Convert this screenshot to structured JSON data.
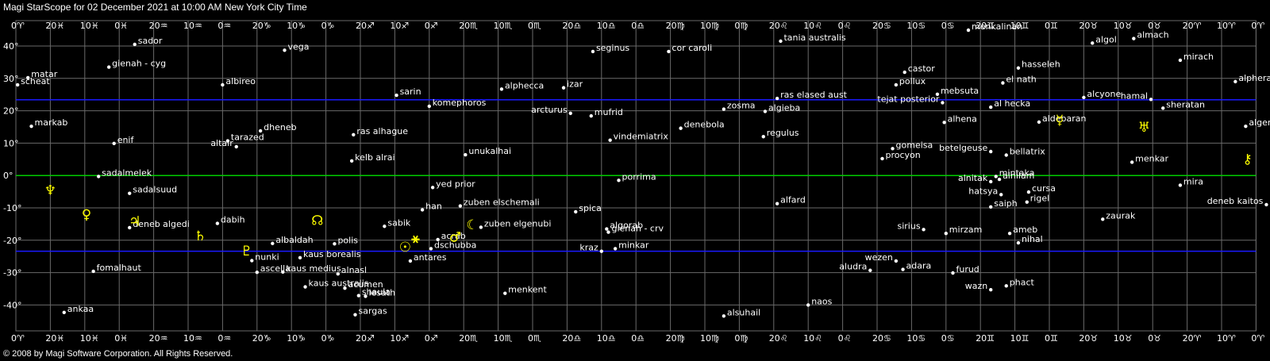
{
  "title": "Magi StarScope for 02 December 2021 at 10:00 AM New York City Time",
  "footer": "© 2008 by Magi Software Corporation. All Rights Reserved.",
  "colors": {
    "background": "#000000",
    "grid": "#6a6a6a",
    "celestial_equator": "#00cc00",
    "ecliptic_bounds": "#1a1aff",
    "star": "#ffffff",
    "planet": "#ffff00"
  },
  "axis": {
    "top_ticks": [
      "0♈",
      "20♓",
      "10♓",
      "0♓",
      "20♒",
      "10♒",
      "0♒",
      "20♑",
      "10♑",
      "0♑",
      "20♐",
      "10♐",
      "0♐",
      "20♏",
      "10♏",
      "0♏",
      "20♎",
      "10♎",
      "0♎",
      "20♍",
      "10♍",
      "0♍",
      "20♌",
      "10♌",
      "0♌",
      "20♋",
      "10♋",
      "0♋",
      "20♊",
      "10♊",
      "0♊",
      "20♉",
      "10♉",
      "0♉",
      "20♈",
      "10♈",
      "0♈"
    ],
    "left_ticks": [
      "40°",
      "30°",
      "20°",
      "10°",
      "0°",
      "-10°",
      "-20°",
      "-30°",
      "-40°"
    ],
    "y_values": [
      40,
      30,
      20,
      10,
      0,
      -10,
      -20,
      -30,
      -40
    ],
    "y_range": [
      -47,
      45
    ],
    "ecliptic_bounds": [
      23.4,
      -23.4
    ]
  },
  "stars": [
    {
      "name": "sador",
      "col": 3.45,
      "dec": 40.5
    },
    {
      "name": "gienah - cyg",
      "col": 2.7,
      "dec": 33.5
    },
    {
      "name": "vega",
      "col": 7.8,
      "dec": 38.7
    },
    {
      "name": "matar",
      "col": 0.35,
      "dec": 30.2
    },
    {
      "name": "scheat",
      "col": 0.05,
      "dec": 28.0
    },
    {
      "name": "albireo",
      "col": 6.0,
      "dec": 28.0
    },
    {
      "name": "markab",
      "col": 0.45,
      "dec": 15.2
    },
    {
      "name": "dheneb",
      "col": 7.1,
      "dec": 13.8
    },
    {
      "name": "enif",
      "col": 2.85,
      "dec": 9.9
    },
    {
      "name": "tarazed",
      "col": 6.15,
      "dec": 10.7
    },
    {
      "name": "altair",
      "col": 6.4,
      "dec": 8.9,
      "label_left": true
    },
    {
      "name": "sadalmelek",
      "col": 2.4,
      "dec": -0.3
    },
    {
      "name": "sadalsuud",
      "col": 3.3,
      "dec": -5.5
    },
    {
      "name": "deneb algedi",
      "col": 3.3,
      "dec": -16.1
    },
    {
      "name": "dabih",
      "col": 5.85,
      "dec": -14.8
    },
    {
      "name": "fomalhaut",
      "col": 2.25,
      "dec": -29.6
    },
    {
      "name": "ankaa",
      "col": 1.4,
      "dec": -42.3
    },
    {
      "name": "sarin",
      "col": 11.05,
      "dec": 24.8
    },
    {
      "name": "komephoros",
      "col": 12.0,
      "dec": 21.4
    },
    {
      "name": "ras alhague",
      "col": 9.8,
      "dec": 12.6
    },
    {
      "name": "kelb alrai",
      "col": 9.75,
      "dec": 4.5
    },
    {
      "name": "yed prior",
      "col": 12.1,
      "dec": -3.7
    },
    {
      "name": "han",
      "col": 11.8,
      "dec": -10.6
    },
    {
      "name": "sabik",
      "col": 10.7,
      "dec": -15.7
    },
    {
      "name": "albaldah",
      "col": 7.45,
      "dec": -21.0
    },
    {
      "name": "polis",
      "col": 9.25,
      "dec": -21.1
    },
    {
      "name": "nunki",
      "col": 6.85,
      "dec": -26.3
    },
    {
      "name": "kaus borealis",
      "col": 8.25,
      "dec": -25.4
    },
    {
      "name": "ascella",
      "col": 7.0,
      "dec": -29.9
    },
    {
      "name": "kaus medius",
      "col": 7.75,
      "dec": -29.8
    },
    {
      "name": "alnasl",
      "col": 9.35,
      "dec": -30.4
    },
    {
      "name": "kaus australis",
      "col": 8.4,
      "dec": -34.4
    },
    {
      "name": "acumen",
      "col": 9.55,
      "dec": -34.8
    },
    {
      "name": "shaula",
      "col": 9.95,
      "dec": -37.1
    },
    {
      "name": "lesath",
      "col": 10.15,
      "dec": -37.3
    },
    {
      "name": "sargas",
      "col": 9.85,
      "dec": -43.0
    },
    {
      "name": "acrab",
      "col": 12.25,
      "dec": -19.8
    },
    {
      "name": "dschubba",
      "col": 12.05,
      "dec": -22.6
    },
    {
      "name": "antares",
      "col": 11.45,
      "dec": -26.4
    },
    {
      "name": "unukalhai",
      "col": 13.05,
      "dec": 6.4
    },
    {
      "name": "zuben elschemali",
      "col": 12.9,
      "dec": -9.4
    },
    {
      "name": "zuben elgenubi",
      "col": 13.5,
      "dec": -16.0
    },
    {
      "name": "menkent",
      "col": 14.2,
      "dec": -36.4
    },
    {
      "name": "alphecca",
      "col": 14.1,
      "dec": 26.7
    },
    {
      "name": "izar",
      "col": 15.9,
      "dec": 27.1
    },
    {
      "name": "arcturus",
      "col": 16.1,
      "dec": 19.2,
      "label_left": true
    },
    {
      "name": "mufrid",
      "col": 16.7,
      "dec": 18.4
    },
    {
      "name": "seginus",
      "col": 16.75,
      "dec": 38.3
    },
    {
      "name": "vindemiatrix",
      "col": 17.25,
      "dec": 10.9
    },
    {
      "name": "spica",
      "col": 16.25,
      "dec": -11.2
    },
    {
      "name": "porrima",
      "col": 17.5,
      "dec": -1.5
    },
    {
      "name": "algorab",
      "col": 17.15,
      "dec": -16.5
    },
    {
      "name": "gienah - crv",
      "col": 17.2,
      "dec": -17.5
    },
    {
      "name": "kraz",
      "col": 17.0,
      "dec": -23.4,
      "label_left": true
    },
    {
      "name": "minkar",
      "col": 17.4,
      "dec": -22.6
    },
    {
      "name": "cor caroli",
      "col": 18.95,
      "dec": 38.3
    },
    {
      "name": "denebola",
      "col": 19.3,
      "dec": 14.6
    },
    {
      "name": "zosma",
      "col": 20.55,
      "dec": 20.5
    },
    {
      "name": "algieba",
      "col": 21.75,
      "dec": 19.8
    },
    {
      "name": "regulus",
      "col": 21.7,
      "dec": 12.0
    },
    {
      "name": "ras elased aust",
      "col": 22.1,
      "dec": 23.8
    },
    {
      "name": "tania australis",
      "col": 22.2,
      "dec": 41.5
    },
    {
      "name": "alfard",
      "col": 22.1,
      "dec": -8.7
    },
    {
      "name": "alsuhail",
      "col": 20.55,
      "dec": -43.4
    },
    {
      "name": "naos",
      "col": 23.0,
      "dec": -40.0
    },
    {
      "name": "castor",
      "col": 25.8,
      "dec": 31.9
    },
    {
      "name": "pollux",
      "col": 25.55,
      "dec": 28.0
    },
    {
      "name": "tejat posterior",
      "col": 26.9,
      "dec": 22.5,
      "label_left": true
    },
    {
      "name": "mebsuta",
      "col": 26.75,
      "dec": 25.1
    },
    {
      "name": "menkalinan",
      "col": 27.65,
      "dec": 44.9
    },
    {
      "name": "el nath",
      "col": 28.65,
      "dec": 28.6
    },
    {
      "name": "hasseleh",
      "col": 29.1,
      "dec": 33.2
    },
    {
      "name": "al hecka",
      "col": 28.3,
      "dec": 21.1
    },
    {
      "name": "alhena",
      "col": 26.95,
      "dec": 16.4
    },
    {
      "name": "gomeisa",
      "col": 25.45,
      "dec": 8.3
    },
    {
      "name": "procyon",
      "col": 25.15,
      "dec": 5.2
    },
    {
      "name": "betelgeuse",
      "col": 28.3,
      "dec": 7.4,
      "label_left": true
    },
    {
      "name": "bellatrix",
      "col": 28.75,
      "dec": 6.3
    },
    {
      "name": "mintaka",
      "col": 28.45,
      "dec": -0.3
    },
    {
      "name": "alnitak",
      "col": 28.3,
      "dec": -1.9,
      "label_left": true
    },
    {
      "name": "alnilam",
      "col": 28.55,
      "dec": -1.2
    },
    {
      "name": "hatsya",
      "col": 28.6,
      "dec": -5.9,
      "label_left": true
    },
    {
      "name": "cursa",
      "col": 29.4,
      "dec": -5.1
    },
    {
      "name": "saiph",
      "col": 28.3,
      "dec": -9.7
    },
    {
      "name": "rigel",
      "col": 29.35,
      "dec": -8.2
    },
    {
      "name": "sirius",
      "col": 26.35,
      "dec": -16.7,
      "label_left": true
    },
    {
      "name": "mirzam",
      "col": 27.0,
      "dec": -17.9
    },
    {
      "name": "ameb",
      "col": 28.85,
      "dec": -17.9
    },
    {
      "name": "nihal",
      "col": 29.1,
      "dec": -20.8
    },
    {
      "name": "wezen",
      "col": 25.55,
      "dec": -26.4,
      "label_left": true
    },
    {
      "name": "adara",
      "col": 25.75,
      "dec": -29.0
    },
    {
      "name": "aludra",
      "col": 24.8,
      "dec": -29.3,
      "label_left": true
    },
    {
      "name": "furud",
      "col": 27.2,
      "dec": -30.1
    },
    {
      "name": "wazn",
      "col": 28.3,
      "dec": -35.3,
      "label_left": true
    },
    {
      "name": "phact",
      "col": 28.75,
      "dec": -34.1
    },
    {
      "name": "aldebaran",
      "col": 29.7,
      "dec": 16.5
    },
    {
      "name": "alcyone",
      "col": 31.0,
      "dec": 24.1
    },
    {
      "name": "algol",
      "col": 31.25,
      "dec": 40.9
    },
    {
      "name": "almach",
      "col": 32.45,
      "dec": 42.3
    },
    {
      "name": "mirach",
      "col": 33.8,
      "dec": 35.6
    },
    {
      "name": "hamal",
      "col": 32.95,
      "dec": 23.5,
      "label_left": true
    },
    {
      "name": "sheratan",
      "col": 33.3,
      "dec": 20.8
    },
    {
      "name": "alpheratz",
      "col": 35.4,
      "dec": 29.0
    },
    {
      "name": "menkar",
      "col": 32.4,
      "dec": 4.1
    },
    {
      "name": "zaurak",
      "col": 31.55,
      "dec": -13.5
    },
    {
      "name": "mira",
      "col": 33.8,
      "dec": -3.0
    },
    {
      "name": "algenib",
      "col": 35.7,
      "dec": 15.2
    },
    {
      "name": "deneb kaitos",
      "col": 36.3,
      "dec": -9.0,
      "label_left": true
    }
  ],
  "planets": [
    {
      "name": "neptune-icon",
      "glyph": "♆",
      "col": 1.0,
      "dec": -4.5
    },
    {
      "name": "venus-icon",
      "glyph": "♀",
      "col": 2.05,
      "dec": -12.0
    },
    {
      "name": "jupiter-icon",
      "glyph": "♃",
      "col": 3.45,
      "dec": -14.0
    },
    {
      "name": "saturn-icon",
      "glyph": "♄",
      "col": 5.35,
      "dec": -18.6
    },
    {
      "name": "pluto-icon",
      "glyph": "♇",
      "col": 6.7,
      "dec": -23.2
    },
    {
      "name": "moon-node-icon",
      "glyph": "☊",
      "col": 8.75,
      "dec": -13.8
    },
    {
      "name": "sun-icon",
      "glyph": "☉",
      "col": 11.3,
      "dec": -22.0
    },
    {
      "name": "vertex-icon",
      "glyph": "⚹",
      "col": 11.6,
      "dec": -19.3
    },
    {
      "name": "mars-icon",
      "glyph": "♂",
      "col": 12.75,
      "dec": -18.9
    },
    {
      "name": "moon-icon",
      "glyph": "☾",
      "col": 13.25,
      "dec": -15.2
    },
    {
      "name": "chiron-icon",
      "glyph": "⚷",
      "col": 35.75,
      "dec": 5.2
    },
    {
      "name": "uranus-icon",
      "glyph": "♅",
      "col": 32.75,
      "dec": 15.0
    },
    {
      "name": "mercury-icon",
      "glyph": "☿",
      "col": 30.3,
      "dec": 17.2
    }
  ]
}
